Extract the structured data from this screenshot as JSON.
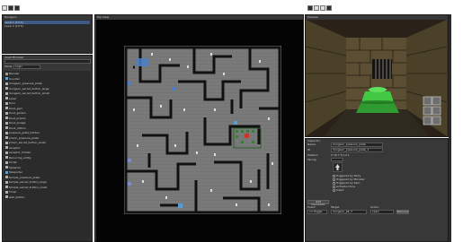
{
  "toolbar": {
    "buttons": [
      "tool-a",
      "tool-b",
      "tool-c"
    ]
  },
  "dungeon_list": {
    "title": "Dungeon",
    "items": [
      {
        "label": "Level 1 (10 6)",
        "selected": true
      },
      {
        "label": "Level 2 (10 6)"
      }
    ]
  },
  "asset_browser": {
    "title": "Asset Browser",
    "search_value": "",
    "filter_label": "Show",
    "filter_value": "Logic",
    "items": [
      {
        "label": "Blender",
        "color": "#9a9a9a"
      },
      {
        "label": "Counter",
        "color": "#5fa0d0"
      },
      {
        "label": "dungeon_pressure_plate",
        "color": "#b0b0b0"
      },
      {
        "label": "dungeon_secret_button_large",
        "color": "#b0b0b0"
      },
      {
        "label": "dungeon_secret_button_small",
        "color": "#b0b0b0"
      },
      {
        "label": "Lever",
        "color": "#b0b0b0"
      },
      {
        "label": "Door",
        "color": "#b0b0b0"
      },
      {
        "label": "Dust_gem",
        "color": "#b0b0b0"
      },
      {
        "label": "Dust_golden",
        "color": "#b0b0b0"
      },
      {
        "label": "Dust_prisms",
        "color": "#b0b0b0"
      },
      {
        "label": "Dust_sludge",
        "color": "#b0b0b0"
      },
      {
        "label": "Dusk_ribbon",
        "color": "#b0b0b0"
      },
      {
        "label": "pressure_plate_hidden",
        "color": "#b0b0b0"
      },
      {
        "label": "prison_pressure_plate",
        "color": "#b0b0b0"
      },
      {
        "label": "prison_secret_button_small",
        "color": "#b0b0b0"
      },
      {
        "label": "receptor",
        "color": "#b0b0b0"
      },
      {
        "label": "receptor_hidden",
        "color": "#b0b0b0"
      },
      {
        "label": "Recurring_entity",
        "color": "#b0b0b0"
      },
      {
        "label": "Script",
        "color": "#b0b0b0"
      },
      {
        "label": "Spawner",
        "color": "#b0b0b0"
      },
      {
        "label": "Teleporter",
        "color": "#5fa0d0"
      },
      {
        "label": "temple_pressure_plate",
        "color": "#b0b0b0"
      },
      {
        "label": "temple_secret_button_large",
        "color": "#b0b0b0"
      },
      {
        "label": "temple_secret_button_small",
        "color": "#b0b0b0"
      },
      {
        "label": "Timer",
        "color": "#b0b0b0"
      },
      {
        "label": "wall_button",
        "color": "#b0b0b0"
      }
    ]
  },
  "map_panel": {
    "title": "Top View"
  },
  "preview_panel": {
    "title": "Preview"
  },
  "inspector": {
    "title": "Inspector",
    "rows": [
      {
        "label": "Name",
        "value": "dungeon_pressure_plate"
      },
      {
        "label": "ID",
        "value": "dungeon_pressure_plate_1"
      },
      {
        "label": "Position",
        "value": "X 16 Y 5 Lvl 1"
      },
      {
        "label": "Facing",
        "value": ""
      }
    ],
    "checkboxes": [
      "Triggered by Party",
      "Triggered by Monster",
      "Triggered by Item",
      "Activate Once",
      "Silent"
    ],
    "connector": {
      "add_button": "Add Connector",
      "headers": [
        "Event",
        "Target",
        "Action"
      ],
      "event_value": "on Toggle",
      "target_value": "dungeon_pit_7",
      "action_value": "open",
      "remove_button": "Remove"
    }
  }
}
